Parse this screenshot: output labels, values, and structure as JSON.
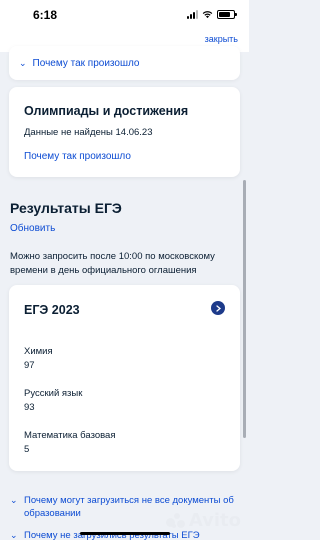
{
  "status_bar": {
    "time": "6:18"
  },
  "top_bar": {
    "close_label": "закрыть"
  },
  "previous_card": {
    "why_link": "Почему так произошло"
  },
  "olympiads": {
    "title": "Олимпиады и достижения",
    "status": "Данные не найдены 14.06.23",
    "why_link": "Почему так произошло"
  },
  "ege": {
    "section_title": "Результаты ЕГЭ",
    "refresh_label": "Обновить",
    "info": "Можно запросить после 10:00 по московскому времени в день официального оглашения",
    "card_title": "ЕГЭ 2023",
    "subjects": [
      {
        "name": "Химия",
        "score": "97"
      },
      {
        "name": "Русский язык",
        "score": "93"
      },
      {
        "name": "Математика базовая",
        "score": "5"
      }
    ]
  },
  "faq": [
    {
      "text": "Почему могут загрузиться не все документы об образовании"
    },
    {
      "text": "Почему не загрузились результаты ЕГЭ"
    }
  ],
  "watermark": {
    "text": "Avito"
  },
  "colors": {
    "link": "#0d4cd3",
    "text": "#0b1f33",
    "background": "#eef1f6",
    "badge": "#1d3a8a"
  }
}
